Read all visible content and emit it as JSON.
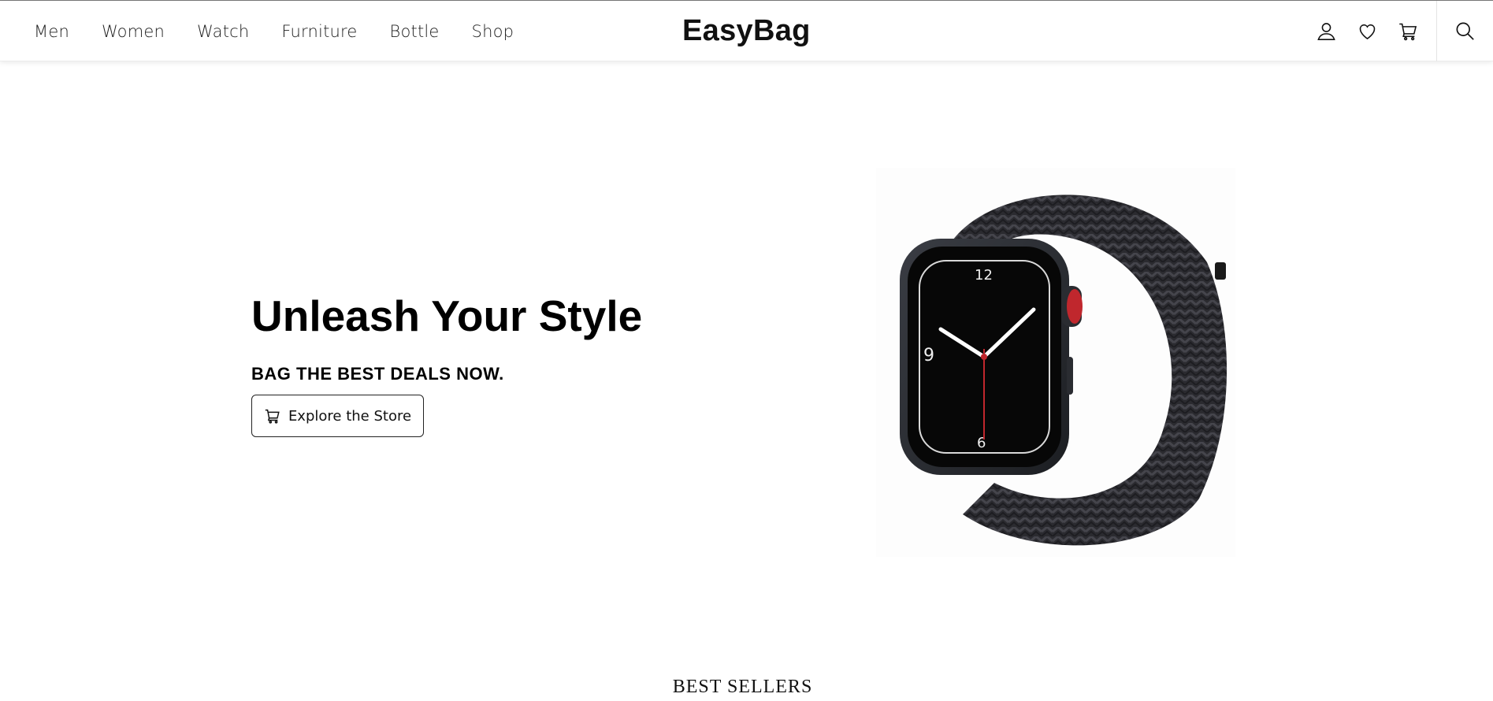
{
  "nav": {
    "items": [
      "Men",
      "Women",
      "Watch",
      "Furniture",
      "Bottle",
      "Shop"
    ]
  },
  "brand": {
    "logo": "EasyBag"
  },
  "header_icons": [
    "user-icon",
    "heart-icon",
    "cart-icon",
    "search-icon"
  ],
  "hero": {
    "title": "Unleash Your Style",
    "subtitle": "BAG THE BEST DEALS NOW.",
    "cta_label": "Explore the Store",
    "cta_icon": "cart-icon",
    "image": "smartwatch-braided-band"
  },
  "sections": {
    "best_sellers_title": "BEST SELLERS"
  },
  "colors": {
    "text": "#111111",
    "background": "#ffffff",
    "band": "#2b2b30",
    "crown_accent": "#c0272d"
  }
}
